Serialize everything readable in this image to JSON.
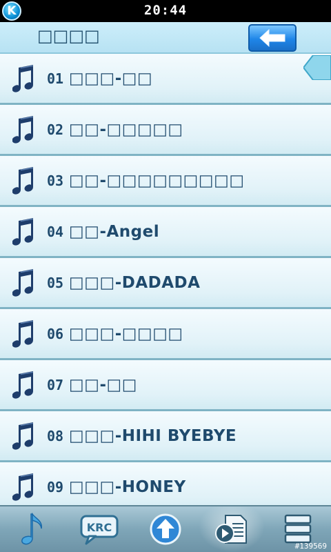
{
  "status": {
    "time": "20:44",
    "logo_letter": "K"
  },
  "header": {
    "title": "□□□□"
  },
  "songs": [
    {
      "num": "01",
      "title": "□□□-□□"
    },
    {
      "num": "02",
      "title": "□□-□□□□□"
    },
    {
      "num": "03",
      "title": "□□-□□□□□□□□□"
    },
    {
      "num": "04",
      "title": "□□-Angel"
    },
    {
      "num": "05",
      "title": "□□□-DADADA"
    },
    {
      "num": "06",
      "title": "□□□-□□□□"
    },
    {
      "num": "07",
      "title": "□□-□□"
    },
    {
      "num": "08",
      "title": "□□□-HIHI BYEBYE"
    },
    {
      "num": "09",
      "title": "□□□-HONEY"
    }
  ],
  "toolbar": {
    "krc_label": "KRC"
  },
  "watermark": "#139569",
  "colors": {
    "accent": "#1f86e8",
    "text": "#1f4a6d",
    "row_divider": "#7fb3c4"
  }
}
